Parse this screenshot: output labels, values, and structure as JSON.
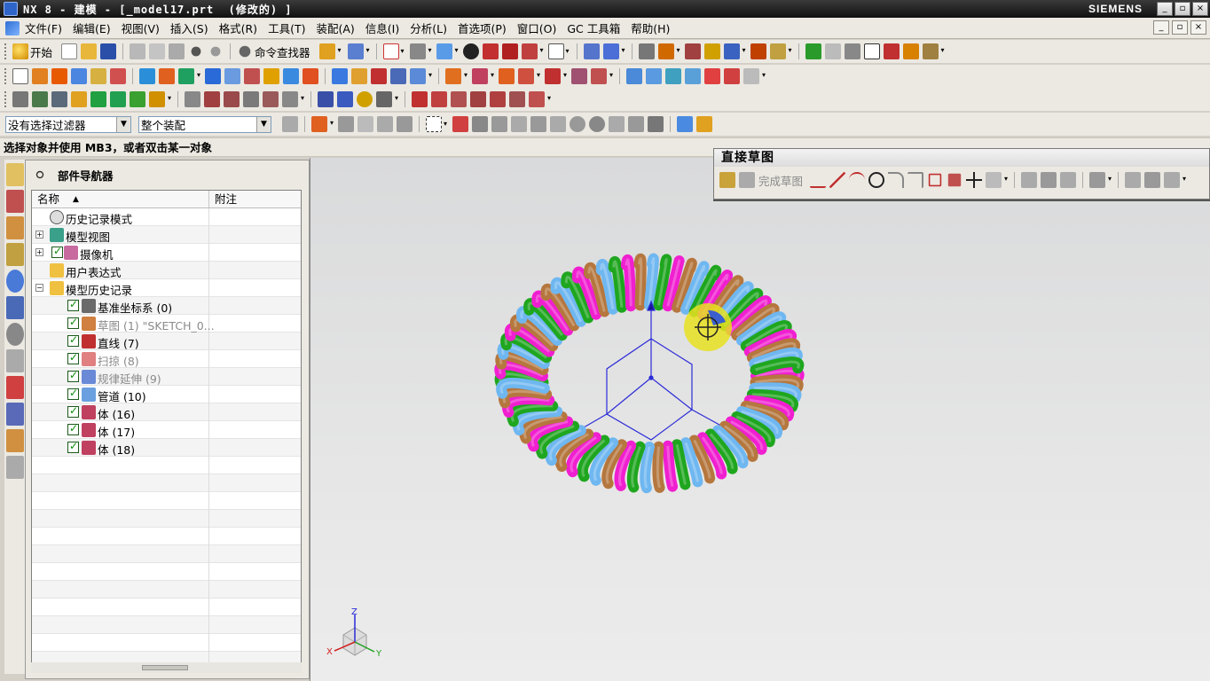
{
  "window": {
    "title": "NX 8 - 建模 - [_model17.prt  (修改的) ]",
    "brand": "SIEMENS",
    "buttons": [
      "_",
      "▫",
      "×"
    ]
  },
  "menu": [
    "文件(F)",
    "编辑(E)",
    "视图(V)",
    "插入(S)",
    "格式(R)",
    "工具(T)",
    "装配(A)",
    "信息(I)",
    "分析(L)",
    "首选项(P)",
    "窗口(O)",
    "GC 工具箱",
    "帮助(H)"
  ],
  "toolbar": {
    "start_label": "开始",
    "command_finder_label": "命令查找器"
  },
  "selection": {
    "filter_value": "没有选择过滤器",
    "scope_value": "整个装配"
  },
  "cue_line": "选择对象并使用 MB3，或者双击某一对象",
  "navigator": {
    "title": "部件导航器",
    "columns": [
      "名称",
      "附注"
    ],
    "rows": [
      {
        "label": "历史记录模式",
        "icon": "clock-icon",
        "level": 0,
        "expander": "",
        "checked": false,
        "dim": false
      },
      {
        "label": "模型视图",
        "icon": "model-view-icon",
        "level": 0,
        "expander": "+",
        "checked": false,
        "dim": false
      },
      {
        "label": "摄像机",
        "icon": "camera-icon",
        "level": 0,
        "expander": "+",
        "checked": true,
        "dim": false
      },
      {
        "label": "用户表达式",
        "icon": "folder-icon",
        "level": 0,
        "expander": "",
        "checked": false,
        "dim": false
      },
      {
        "label": "模型历史记录",
        "icon": "folder-open-icon",
        "level": 0,
        "expander": "-",
        "checked": false,
        "dim": false
      },
      {
        "label": "基准坐标系 (0)",
        "icon": "datum-csys-icon",
        "level": 1,
        "expander": "",
        "checked": true,
        "dim": false
      },
      {
        "label": "草图 (1) \"SKETCH_0...",
        "icon": "sketch-icon",
        "level": 1,
        "expander": "",
        "checked": true,
        "dim": true
      },
      {
        "label": "直线 (7)",
        "icon": "line-icon",
        "level": 1,
        "expander": "",
        "checked": true,
        "dim": false
      },
      {
        "label": "扫掠 (8)",
        "icon": "sweep-icon",
        "level": 1,
        "expander": "",
        "checked": true,
        "dim": true
      },
      {
        "label": "规律延伸 (9)",
        "icon": "law-extension-icon",
        "level": 1,
        "expander": "",
        "checked": true,
        "dim": true
      },
      {
        "label": "管道 (10)",
        "icon": "tube-icon",
        "level": 1,
        "expander": "",
        "checked": true,
        "dim": false
      },
      {
        "label": "体 (16)",
        "icon": "body-icon",
        "level": 1,
        "expander": "",
        "checked": true,
        "dim": false
      },
      {
        "label": "体 (17)",
        "icon": "body-icon",
        "level": 1,
        "expander": "",
        "checked": true,
        "dim": false
      },
      {
        "label": "体 (18)",
        "icon": "body-icon",
        "level": 1,
        "expander": "",
        "checked": true,
        "dim": false
      }
    ]
  },
  "sketch_toolbar": {
    "title": "直接草图",
    "finish_label": "完成草图"
  },
  "triad": {
    "x": "X",
    "y": "Y",
    "z": "Z"
  },
  "colors": {
    "coil_pink": "#f01fd0",
    "coil_brown": "#b5773e",
    "coil_blue": "#6fb7f0",
    "coil_green": "#1fa61f",
    "csys_blue": "#2b2bd8"
  }
}
